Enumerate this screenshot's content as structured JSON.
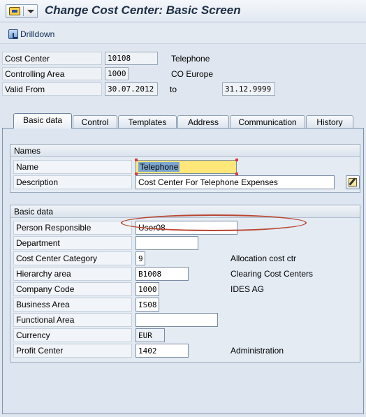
{
  "window": {
    "title": "Change Cost Center: Basic Screen"
  },
  "toolbar": {
    "drilldown_label": "Drilldown"
  },
  "header": {
    "cost_center": {
      "label": "Cost Center",
      "value": "10108",
      "desc": "Telephone"
    },
    "controlling_area": {
      "label": "Controlling Area",
      "value": "1000",
      "desc": "CO Europe"
    },
    "valid_from": {
      "label": "Valid From",
      "value": "30.07.2012",
      "to_label": "to",
      "to_value": "31.12.9999"
    }
  },
  "tabs": [
    {
      "label": "Basic data",
      "active": true
    },
    {
      "label": "Control"
    },
    {
      "label": "Templates"
    },
    {
      "label": "Address"
    },
    {
      "label": "Communication"
    },
    {
      "label": "History"
    }
  ],
  "names_group": {
    "title": "Names",
    "name": {
      "label": "Name",
      "value": "Telephone"
    },
    "description": {
      "label": "Description",
      "value": "Cost Center For Telephone Expenses"
    }
  },
  "basic_group": {
    "title": "Basic data",
    "person_responsible": {
      "label": "Person Responsible",
      "value": "User08"
    },
    "department": {
      "label": "Department",
      "value": ""
    },
    "cost_center_category": {
      "label": "Cost Center Category",
      "value": "9",
      "desc": "Allocation cost ctr"
    },
    "hierarchy_area": {
      "label": "Hierarchy area",
      "value": "B1008",
      "desc": "Clearing Cost Centers"
    },
    "company_code": {
      "label": "Company Code",
      "value": "1000",
      "desc": "IDES AG"
    },
    "business_area": {
      "label": "Business Area",
      "value": "IS08"
    },
    "functional_area": {
      "label": "Functional Area",
      "value": ""
    },
    "currency": {
      "label": "Currency",
      "value": "EUR"
    },
    "profit_center": {
      "label": "Profit Center",
      "value": "1402",
      "desc": "Administration"
    }
  },
  "colors": {
    "highlight": "#b9442f",
    "focus_field": "#ffe77a"
  }
}
